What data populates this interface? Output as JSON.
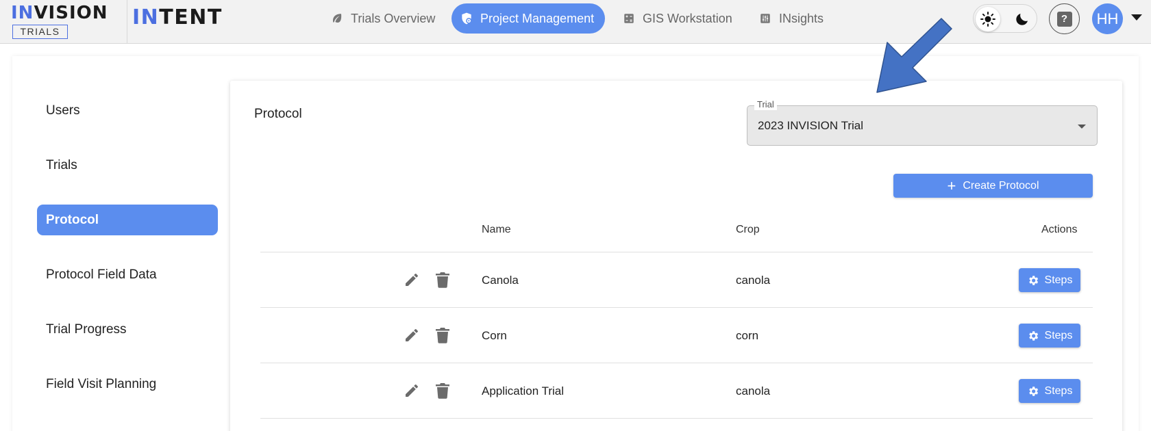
{
  "header": {
    "logo_primary": {
      "accent": "IN",
      "rest": "VISION",
      "sub": "TRIALS"
    },
    "logo_secondary": {
      "accent": "IN",
      "rest": "TENT"
    },
    "nav": [
      {
        "label": "Trials Overview",
        "icon": "leaf-icon",
        "active": false
      },
      {
        "label": "Project Management",
        "icon": "shield-gear-icon",
        "active": true
      },
      {
        "label": "GIS Workstation",
        "icon": "calculator-icon",
        "active": false
      },
      {
        "label": "INsights",
        "icon": "sliders-icon",
        "active": false
      }
    ],
    "theme": {
      "light_icon": "sun-icon",
      "dark_icon": "moon-icon",
      "selected": "light"
    },
    "help_icon": "help-icon",
    "user_initials": "HH"
  },
  "sidebar": {
    "items": [
      {
        "label": "Users",
        "active": false
      },
      {
        "label": "Trials",
        "active": false
      },
      {
        "label": "Protocol",
        "active": true
      },
      {
        "label": "Protocol Field Data",
        "active": false
      },
      {
        "label": "Trial Progress",
        "active": false
      },
      {
        "label": "Field Visit Planning",
        "active": false
      }
    ]
  },
  "main": {
    "title": "Protocol",
    "trial_select": {
      "label": "Trial",
      "value": "2023 INVISION Trial"
    },
    "create_label": "Create Protocol",
    "table": {
      "columns": [
        "Name",
        "Crop",
        "Actions"
      ],
      "rows": [
        {
          "name": "Canola",
          "crop": "canola",
          "action": "Steps"
        },
        {
          "name": "Corn",
          "crop": "corn",
          "action": "Steps"
        },
        {
          "name": "Application Trial",
          "crop": "canola",
          "action": "Steps"
        }
      ]
    }
  },
  "colors": {
    "accent": "#5b8dee",
    "logo_accent": "#4c6fe0",
    "annotation_arrow": "#4472c4"
  }
}
